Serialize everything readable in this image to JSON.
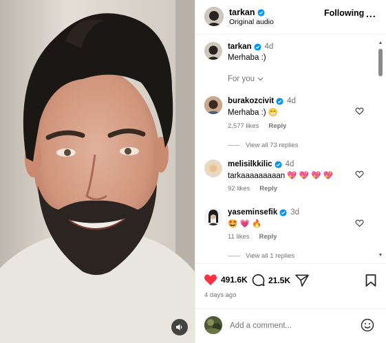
{
  "header": {
    "username": "tarkan",
    "subtitle": "Original audio",
    "follow_label": "Following",
    "more_label": "..."
  },
  "caption": {
    "username": "tarkan",
    "age": "4d",
    "text": "Merhaba :)"
  },
  "sort_label": "For you",
  "comments": [
    {
      "username": "burakozcivit",
      "age": "4d",
      "text": "Merhaba :) 😁",
      "likes": "2,577 likes",
      "reply": "Reply",
      "replies": "View all 73 replies"
    },
    {
      "username": "melisilkkilic",
      "age": "4d",
      "text": "tarkaaaaaaaaan 💖 💖 💖 💖",
      "likes": "92 likes",
      "reply": "Reply"
    },
    {
      "username": "yaseminsefik",
      "age": "3d",
      "text": "🤩 💗 🔥",
      "likes": "11 likes",
      "reply": "Reply",
      "replies": "View all 1 replies"
    }
  ],
  "actions": {
    "like_count": "491.6K",
    "comment_count": "21.5K",
    "posted_ago": "4 days ago"
  },
  "add_comment": {
    "placeholder": "Add a comment..."
  },
  "colors": {
    "verified": "#0095f6",
    "liked": "#ff3040",
    "muted_text": "#737373",
    "divider": "#efefef"
  },
  "icons": [
    "speaker-icon",
    "verified-icon",
    "more-icon",
    "chevron-down-icon",
    "heart-outline-icon",
    "heart-filled-icon",
    "comment-icon",
    "share-icon",
    "bookmark-icon",
    "emoji-icon"
  ]
}
